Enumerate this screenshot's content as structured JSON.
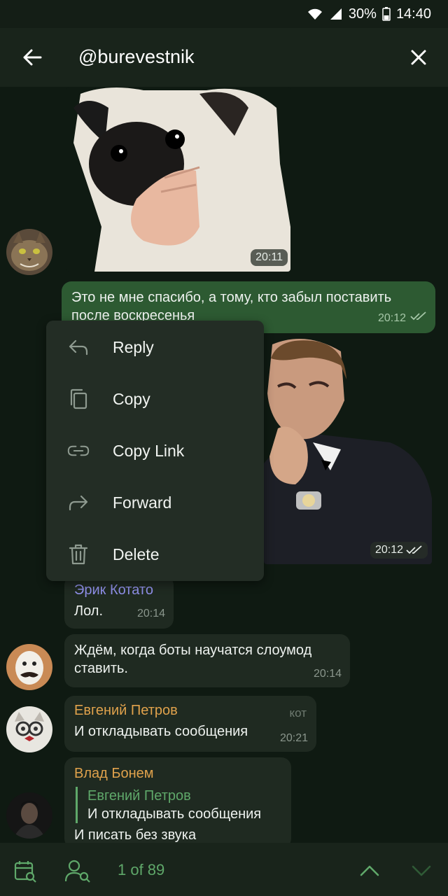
{
  "status_bar": {
    "battery": "30%",
    "time": "14:40"
  },
  "header": {
    "title": "@burevestnik"
  },
  "messages": {
    "sticker_pug": {
      "time": "20:11"
    },
    "out_text": {
      "text_line1": "Это не мне спасибо, а тому, кто забыл поставить",
      "text_line2": "после воскресенья",
      "time": "20:12"
    },
    "sticker_gosling": {
      "time": "20:12"
    },
    "erik": {
      "name": "Эрик Котато",
      "text": "Лол.",
      "time": "20:14"
    },
    "bots": {
      "text_line1": "Ждём, когда боты научатся слоумод",
      "text_line2": "ставить.",
      "time": "20:14"
    },
    "evgeniy": {
      "name": "Евгений Петров",
      "tag": "кот",
      "text": "И откладывать сообщения",
      "time": "20:21"
    },
    "vlad": {
      "name": "Влад Бонем",
      "reply_name": "Евгений Петров",
      "reply_text": "И откладывать сообщения",
      "text": "И писать без звука"
    }
  },
  "context_menu": {
    "items": [
      {
        "label": "Reply",
        "icon": "reply-icon"
      },
      {
        "label": "Copy",
        "icon": "copy-icon"
      },
      {
        "label": "Copy Link",
        "icon": "link-icon"
      },
      {
        "label": "Forward",
        "icon": "forward-icon"
      },
      {
        "label": "Delete",
        "icon": "trash-icon"
      }
    ]
  },
  "bottom_bar": {
    "counter": "1 of 89"
  },
  "colors": {
    "accent_green": "#5fa86a",
    "erik_name": "#8f8fe8",
    "evgeniy_name": "#e0a24c",
    "vlad_name": "#e0a24c",
    "reply_name": "#5fa86a"
  }
}
